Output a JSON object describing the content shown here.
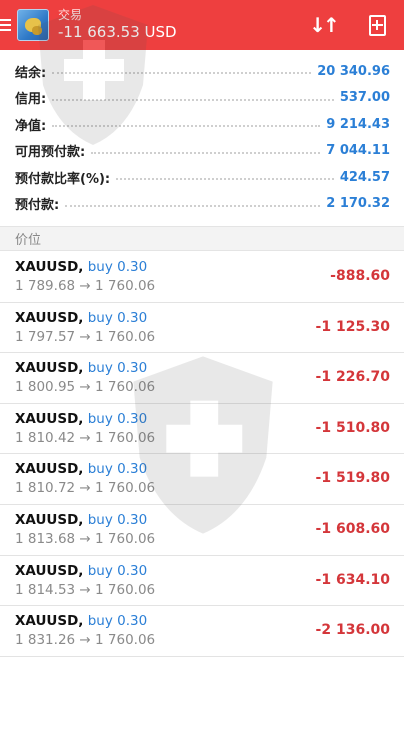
{
  "header": {
    "subtitle": "交易",
    "balance_title": "-11 663.53 USD",
    "sort_icon": "sort-icon",
    "add_icon": "new-order-icon"
  },
  "summary": [
    {
      "label": "结余:",
      "value": "20 340.96"
    },
    {
      "label": "信用:",
      "value": "537.00"
    },
    {
      "label": "净值:",
      "value": "9 214.43"
    },
    {
      "label": "可用预付款:",
      "value": "7 044.11"
    },
    {
      "label": "预付款比率(%):",
      "value": "424.57"
    },
    {
      "label": "预付款:",
      "value": "2 170.32"
    }
  ],
  "section_title": "价位",
  "positions": [
    {
      "symbol": "XAUUSD,",
      "side": "buy 0.30",
      "prices": "1 789.68 → 1 760.06",
      "profit": "-888.60"
    },
    {
      "symbol": "XAUUSD,",
      "side": "buy 0.30",
      "prices": "1 797.57 → 1 760.06",
      "profit": "-1 125.30"
    },
    {
      "symbol": "XAUUSD,",
      "side": "buy 0.30",
      "prices": "1 800.95 → 1 760.06",
      "profit": "-1 226.70"
    },
    {
      "symbol": "XAUUSD,",
      "side": "buy 0.30",
      "prices": "1 810.42 → 1 760.06",
      "profit": "-1 510.80"
    },
    {
      "symbol": "XAUUSD,",
      "side": "buy 0.30",
      "prices": "1 810.72 → 1 760.06",
      "profit": "-1 519.80"
    },
    {
      "symbol": "XAUUSD,",
      "side": "buy 0.30",
      "prices": "1 813.68 → 1 760.06",
      "profit": "-1 608.60"
    },
    {
      "symbol": "XAUUSD,",
      "side": "buy 0.30",
      "prices": "1 814.53 → 1 760.06",
      "profit": "-1 634.10"
    },
    {
      "symbol": "XAUUSD,",
      "side": "buy 0.30",
      "prices": "1 831.26 → 1 760.06",
      "profit": "-2 136.00"
    }
  ],
  "colors": {
    "header_bg": "#ee3f3f",
    "value_blue": "#2b7fd6",
    "loss_red": "#d4363a"
  }
}
